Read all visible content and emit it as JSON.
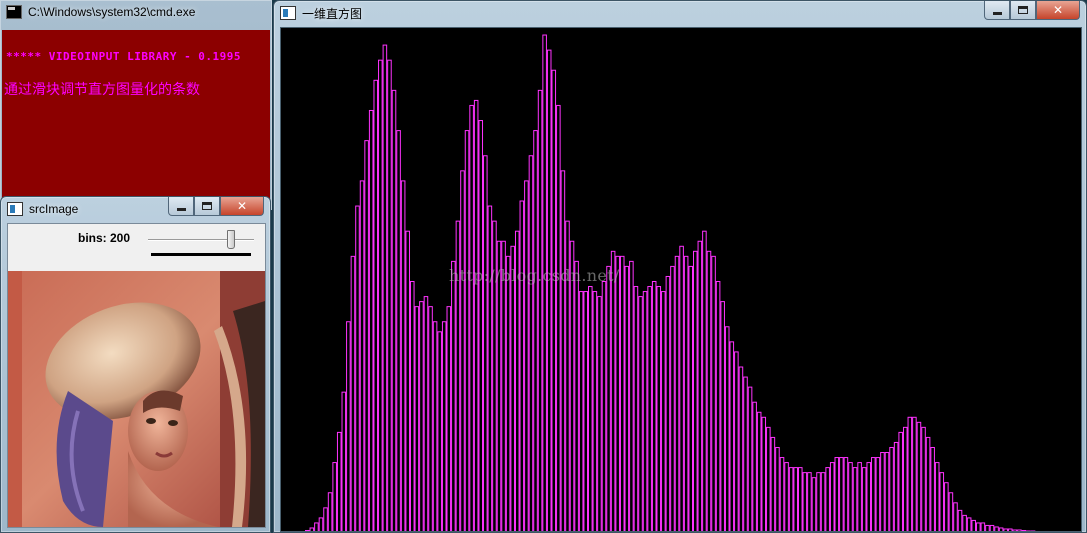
{
  "cmd_window": {
    "title": "C:\\Windows\\system32\\cmd.exe",
    "icon": "console-icon",
    "line1": "***** VIDEOINPUT LIBRARY - 0.1995",
    "line2": "通过滑块调节直方图量化的条数",
    "background_color": "#8c0000",
    "text_color": "#ff00ff"
  },
  "src_window": {
    "title": "srcImage",
    "icon": "opencv-window-icon",
    "trackbar_label": "bins: 200",
    "trackbar_value_fraction": 0.78
  },
  "hist_window": {
    "title": "一维直方图",
    "icon": "opencv-window-icon",
    "watermark": "http://blog.csdn.net/",
    "bar_color": "#ff33ff",
    "background_color": "#000000"
  },
  "window_controls": {
    "minimize": "minimize-icon",
    "maximize": "maximize-icon",
    "close": "close-icon"
  },
  "chart_data": {
    "type": "bar",
    "title": "",
    "xlabel": "",
    "ylabel": "",
    "ylim": [
      0,
      100
    ],
    "bins": 200,
    "values": [
      0.5,
      1,
      2,
      3,
      5,
      8,
      14,
      20,
      28,
      42,
      55,
      65,
      70,
      78,
      84,
      90,
      94,
      97,
      94,
      88,
      80,
      70,
      60,
      50,
      45,
      46,
      47,
      45,
      42,
      40,
      42,
      45,
      54,
      62,
      72,
      80,
      85,
      86,
      82,
      75,
      65,
      62,
      58,
      58,
      55,
      57,
      60,
      66,
      70,
      75,
      80,
      88,
      99,
      96,
      92,
      85,
      72,
      62,
      58,
      54,
      48,
      48,
      49,
      48,
      47,
      50,
      53,
      56,
      55,
      55,
      53,
      54,
      49,
      47,
      48,
      49,
      50,
      49,
      48,
      51,
      53,
      55,
      57,
      55,
      53,
      56,
      58,
      60,
      56,
      55,
      50,
      46,
      41,
      38,
      36,
      33,
      31,
      29,
      26,
      24,
      23,
      21,
      19,
      17,
      15,
      14,
      13,
      13,
      13,
      12,
      12,
      11,
      12,
      12,
      13,
      14,
      15,
      15,
      15,
      14,
      13,
      14,
      13,
      14,
      15,
      15,
      16,
      16,
      17,
      18,
      20,
      21,
      23,
      23,
      22,
      21,
      19,
      17,
      14,
      12,
      10,
      8,
      6,
      4.5,
      3.5,
      3,
      2.5,
      2,
      2,
      1.5,
      1.5,
      1.2,
      1,
      0.8,
      0.8,
      0.6,
      0.6,
      0.5,
      0.4,
      0.4,
      0.3,
      0.2,
      0.3,
      0.2,
      0.2,
      0.1,
      0.2,
      0.1,
      0.1,
      0.1
    ]
  }
}
